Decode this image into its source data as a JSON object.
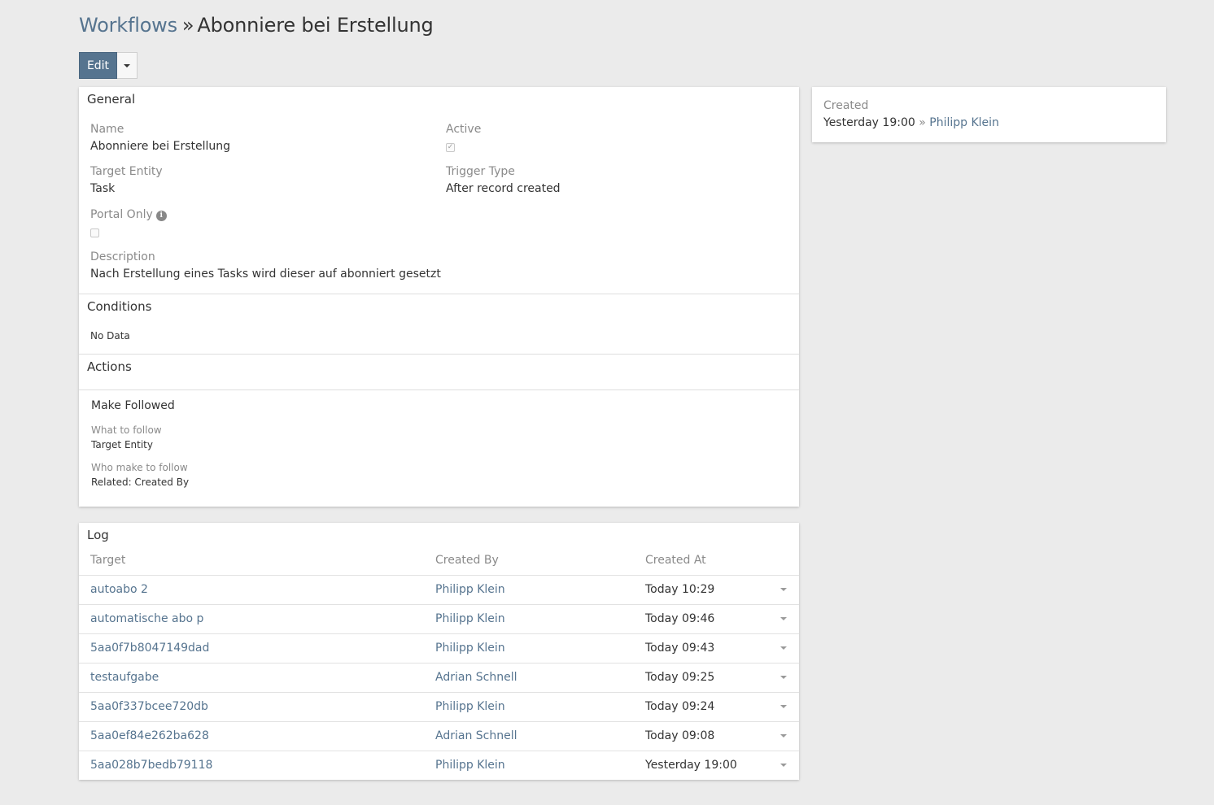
{
  "header": {
    "breadcrumb_link": "Workflows",
    "separator": "»",
    "title": "Abonniere bei Erstellung"
  },
  "toolbar": {
    "edit_label": "Edit"
  },
  "general": {
    "section_title": "General",
    "name_label": "Name",
    "name_value": "Abonniere bei Erstellung",
    "active_label": "Active",
    "active_checked": true,
    "target_entity_label": "Target Entity",
    "target_entity_value": "Task",
    "trigger_type_label": "Trigger Type",
    "trigger_type_value": "After record created",
    "portal_only_label": "Portal Only",
    "portal_only_checked": false,
    "description_label": "Description",
    "description_value": "Nach Erstellung eines Tasks wird dieser auf abonniert gesetzt"
  },
  "conditions": {
    "section_title": "Conditions",
    "empty_text": "No Data"
  },
  "actions": {
    "section_title": "Actions",
    "action_title": "Make Followed",
    "what_label": "What to follow",
    "what_value": "Target Entity",
    "who_label": "Who make to follow",
    "who_value": "Related: Created By"
  },
  "side": {
    "created_label": "Created",
    "created_time": "Yesterday 19:00",
    "created_sep": "»",
    "created_user": "Philipp Klein"
  },
  "log": {
    "section_title": "Log",
    "columns": [
      "Target",
      "Created By",
      "Created At"
    ],
    "rows": [
      {
        "target": "autoabo 2",
        "by": "Philipp Klein",
        "at": "Today 10:29"
      },
      {
        "target": "automatische abo p",
        "by": "Philipp Klein",
        "at": "Today 09:46"
      },
      {
        "target": "5aa0f7b8047149dad",
        "by": "Philipp Klein",
        "at": "Today 09:43"
      },
      {
        "target": "testaufgabe",
        "by": "Adrian Schnell",
        "at": "Today 09:25"
      },
      {
        "target": "5aa0f337bcee720db",
        "by": "Philipp Klein",
        "at": "Today 09:24"
      },
      {
        "target": "5aa0ef84e262ba628",
        "by": "Adrian Schnell",
        "at": "Today 09:08"
      },
      {
        "target": "5aa028b7bedb79118",
        "by": "Philipp Klein",
        "at": "Yesterday 19:00"
      }
    ]
  },
  "colors": {
    "link": "#56748f",
    "background": "#ebebeb",
    "primary_button": "#56748f"
  }
}
